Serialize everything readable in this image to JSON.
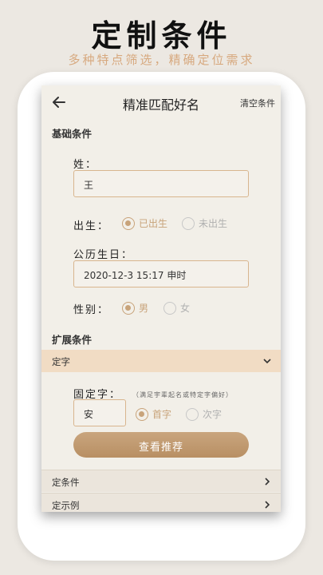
{
  "header": {
    "headline": "定制条件",
    "tagline": "多种特点筛选，精确定位需求"
  },
  "topbar": {
    "back_icon": "arrow-left-icon",
    "title": "精准匹配好名",
    "clear_label": "清空条件"
  },
  "basic": {
    "section_title": "基础条件",
    "surname_label": "姓：",
    "surname_value": "王",
    "birth_label": "出生：",
    "birth_options": [
      "已出生",
      "未出生"
    ],
    "birth_selected": "已出生",
    "birthday_label": "公历生日：",
    "birthday_value": "2020-12-3 15:17 申时",
    "gender_label": "性别：",
    "gender_options": [
      "男",
      "女"
    ],
    "gender_selected": "男"
  },
  "extended": {
    "section_title": "扩展条件",
    "fixed_char_bar": "定字",
    "fixed_char_label": "固定字：",
    "fixed_char_hint": "（满足宇辈起名或特定字偏好）",
    "fixed_char_value": "安",
    "position_options": [
      "首字",
      "次字"
    ],
    "position_selected": "首字"
  },
  "cta_label": "查看推荐",
  "rows": [
    "定条件",
    "定示例"
  ],
  "colors": {
    "accent": "#c8a37a",
    "tagline": "#d7a97f",
    "tan_bar": "#f1dcc4"
  }
}
